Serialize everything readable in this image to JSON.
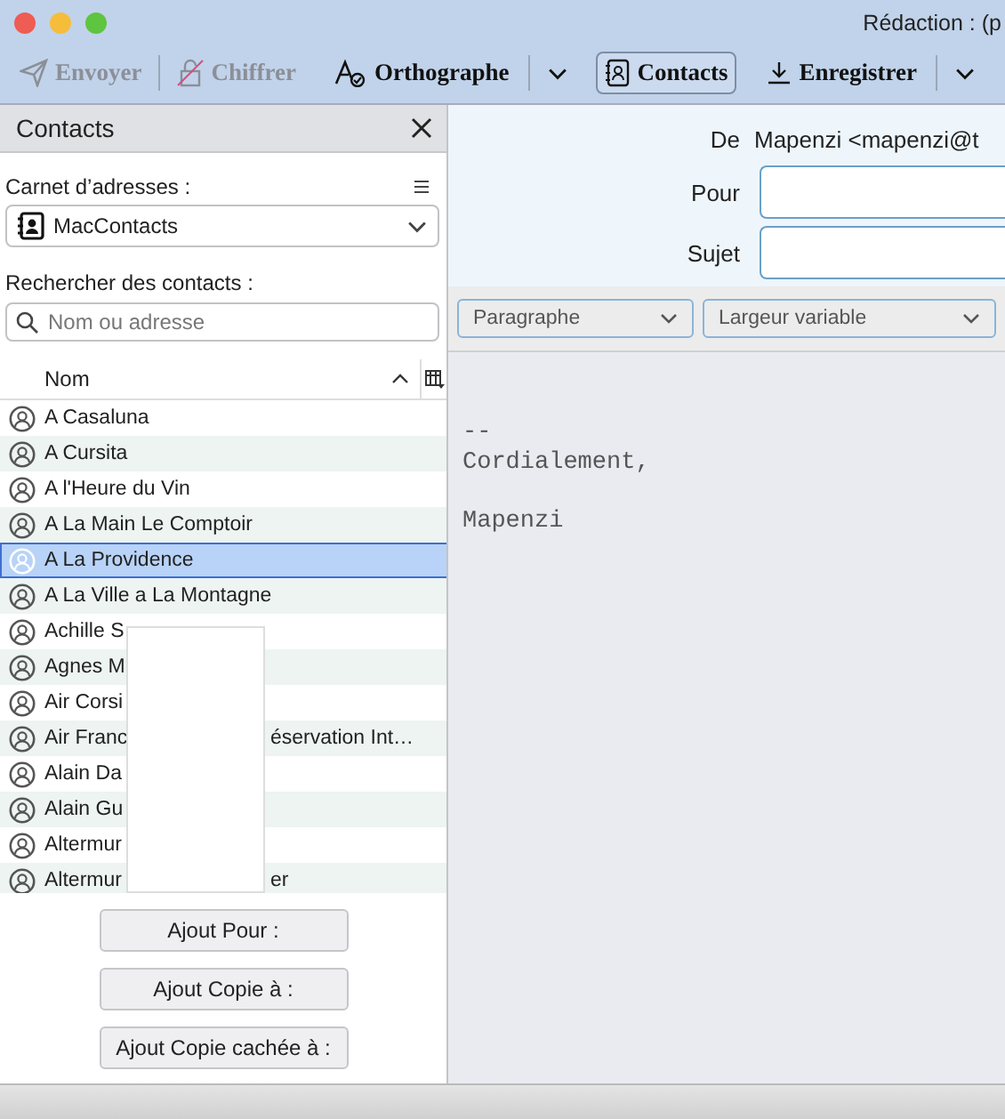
{
  "window": {
    "title": "Rédaction : (p"
  },
  "toolbar": [
    {
      "label": "Envoyer",
      "kind": "send",
      "disabled": true,
      "selected": false,
      "dropdown": false
    },
    {
      "label": "Chiffrer",
      "kind": "encrypt",
      "disabled": true,
      "selected": false,
      "dropdown": false
    },
    {
      "label": "Orthographe",
      "kind": "spell",
      "disabled": false,
      "selected": false,
      "dropdown": true
    },
    {
      "label": "Contacts",
      "kind": "contacts",
      "disabled": false,
      "selected": true,
      "dropdown": false
    },
    {
      "label": "Enregistrer",
      "kind": "save",
      "disabled": false,
      "selected": false,
      "dropdown": true
    }
  ],
  "sidebar": {
    "title": "Contacts",
    "address_book_label": "Carnet d’adresses :",
    "address_book": "MacContacts",
    "search_label": "Rechercher des contacts :",
    "search": {
      "placeholder": "Nom ou adresse"
    },
    "column": "Nom",
    "contacts": [
      {
        "name": "A Casaluna",
        "selected": false
      },
      {
        "name": "A Cursita",
        "selected": false
      },
      {
        "name": "A l'Heure du Vin",
        "selected": false
      },
      {
        "name": "A La Main Le Comptoir",
        "selected": false
      },
      {
        "name": "A La Providence",
        "selected": true
      },
      {
        "name": "A La Ville a La Montagne",
        "selected": false
      },
      {
        "name": "Achille S",
        "selected": false
      },
      {
        "name": "Agnes M",
        "selected": false
      },
      {
        "name": "Air Corsi",
        "selected": false
      },
      {
        "name": "Air Franc",
        "tail": "éservation Int…",
        "selected": false
      },
      {
        "name": "Alain Da",
        "selected": false
      },
      {
        "name": "Alain Gu",
        "selected": false
      },
      {
        "name": "Altermur",
        "selected": false
      },
      {
        "name": "Altermur",
        "tail": "er",
        "selected": false
      }
    ],
    "buttons": [
      "Ajout Pour :",
      "Ajout Copie à :",
      "Ajout Copie cachée à :"
    ]
  },
  "compose": {
    "from_label": "De",
    "from": "Mapenzi <mapenzi@t",
    "to_label": "Pour",
    "subject_label": "Sujet",
    "paragraph_format": "Paragraphe",
    "font": "Largeur variable",
    "body": [
      {
        "text": "--",
        "space_before": false
      },
      {
        "text": "Cordialement,",
        "space_before": false
      },
      {
        "text": "Mapenzi",
        "space_before": true
      }
    ]
  }
}
